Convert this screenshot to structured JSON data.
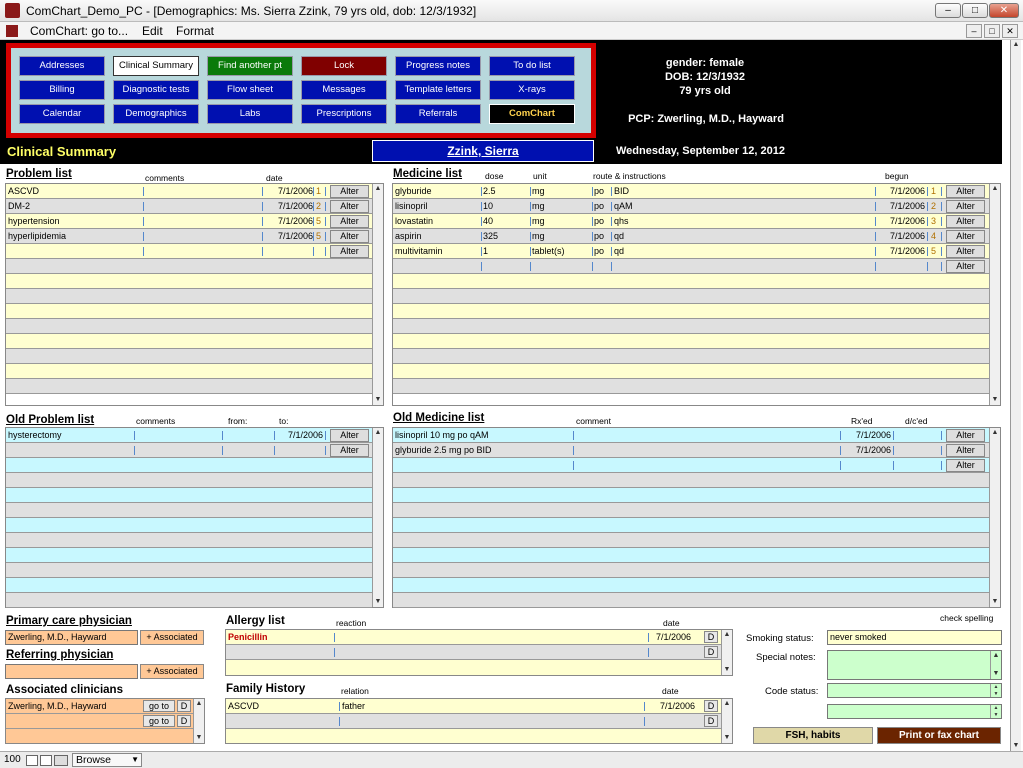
{
  "window": {
    "title": "ComChart_Demo_PC - [Demographics: Ms. Sierra Zzink, 79 yrs old, dob: 12/3/1932]",
    "minimize": "–",
    "maximize": "□",
    "close": "✕"
  },
  "menu": {
    "items": [
      "ComChart: go to...",
      "Edit",
      "Format"
    ]
  },
  "nav": {
    "row1": [
      "Addresses",
      "Clinical Summary",
      "Find another pt",
      "Lock",
      "Progress notes",
      "To do list"
    ],
    "row2": [
      "Billing",
      "Diagnostic tests",
      "Flow sheet",
      "Messages",
      "Template letters",
      "X-rays"
    ],
    "row3": [
      "Calendar",
      "Demographics",
      "Labs",
      "Prescriptions",
      "Referrals",
      "ComChart"
    ]
  },
  "patient": {
    "gender": "gender: female",
    "dob": "DOB: 12/3/1932",
    "age": "79 yrs old",
    "pcp": "PCP: Zwerling, M.D., Hayward",
    "name": "Zzink, Sierra"
  },
  "page_title": "Clinical Summary",
  "date": "Wednesday, September 12, 2012",
  "alter": "Alter",
  "problems": {
    "title": "Problem list",
    "h_comments": "comments",
    "h_date": "date",
    "rows": [
      {
        "name": "ASCVD",
        "date": "7/1/2006",
        "n": "1"
      },
      {
        "name": "DM-2",
        "date": "7/1/2006",
        "n": "2"
      },
      {
        "name": "hypertension",
        "date": "7/1/2006",
        "n": "5"
      },
      {
        "name": "hyperlipidemia",
        "date": "7/1/2006",
        "n": "5"
      },
      {
        "name": "",
        "date": "",
        "n": ""
      }
    ]
  },
  "medicines": {
    "title": "Medicine list",
    "h_dose": "dose",
    "h_unit": "unit",
    "h_route": "route & instructions",
    "h_begun": "begun",
    "rows": [
      {
        "name": "glyburide",
        "dose": "2.5",
        "unit": "mg",
        "route": "po",
        "instr": "BID",
        "date": "7/1/2006",
        "n": "1"
      },
      {
        "name": "lisinopril",
        "dose": "10",
        "unit": "mg",
        "route": "po",
        "instr": "qAM",
        "date": "7/1/2006",
        "n": "2"
      },
      {
        "name": "lovastatin",
        "dose": "40",
        "unit": "mg",
        "route": "po",
        "instr": "qhs",
        "date": "7/1/2006",
        "n": "3"
      },
      {
        "name": "aspirin",
        "dose": "325",
        "unit": "mg",
        "route": "po",
        "instr": "qd",
        "date": "7/1/2006",
        "n": "4"
      },
      {
        "name": "multivitamin",
        "dose": "1",
        "unit": "tablet(s)",
        "route": "po",
        "instr": "qd",
        "date": "7/1/2006",
        "n": "5"
      },
      {
        "name": "",
        "dose": "",
        "unit": "",
        "route": "",
        "instr": "",
        "date": "",
        "n": ""
      }
    ]
  },
  "old_problems": {
    "title": "Old Problem list",
    "h_comments": "comments",
    "h_from": "from:",
    "h_to": "to:",
    "rows": [
      {
        "name": "hysterectomy",
        "date": "7/1/2006"
      },
      {
        "name": "",
        "date": ""
      }
    ]
  },
  "old_medicines": {
    "title": "Old Medicine list",
    "h_comment": "comment",
    "h_rxed": "Rx'ed",
    "h_dced": "d/c'ed",
    "rows": [
      {
        "name": "lisinopril 10 mg po qAM",
        "date": "7/1/2006"
      },
      {
        "name": "glyburide 2.5 mg po BID",
        "date": "7/1/2006"
      },
      {
        "name": "",
        "date": ""
      }
    ]
  },
  "pcp": {
    "title": "Primary care physician",
    "value": "Zwerling, M.D., Hayward",
    "assoc": "+ Associated"
  },
  "referring": {
    "title": "Referring physician",
    "value": "",
    "assoc": "+ Associated"
  },
  "associated": {
    "title": "Associated clinicians",
    "rows": [
      {
        "name": "Zwerling, M.D., Hayward"
      },
      {
        "name": ""
      }
    ],
    "goto": "go to",
    "d": "D"
  },
  "allergy": {
    "title": "Allergy list",
    "h_reaction": "reaction",
    "h_date": "date",
    "rows": [
      {
        "name": "Penicillin",
        "date": "7/1/2006"
      },
      {
        "name": "",
        "date": ""
      }
    ],
    "d": "D"
  },
  "family": {
    "title": "Family History",
    "h_relation": "relation",
    "h_date": "date",
    "rows": [
      {
        "name": "ASCVD",
        "relation": "father",
        "date": "7/1/2006"
      },
      {
        "name": "",
        "relation": "",
        "date": ""
      }
    ],
    "d": "D"
  },
  "right": {
    "check_spelling": "check spelling",
    "smoking_label": "Smoking status:",
    "smoking_value": "never smoked",
    "notes_label": "Special notes:",
    "code_label": "Code status:",
    "fsh": "FSH, habits",
    "print": "Print or fax chart"
  },
  "status": {
    "zoom": "100",
    "mode": "Browse"
  }
}
